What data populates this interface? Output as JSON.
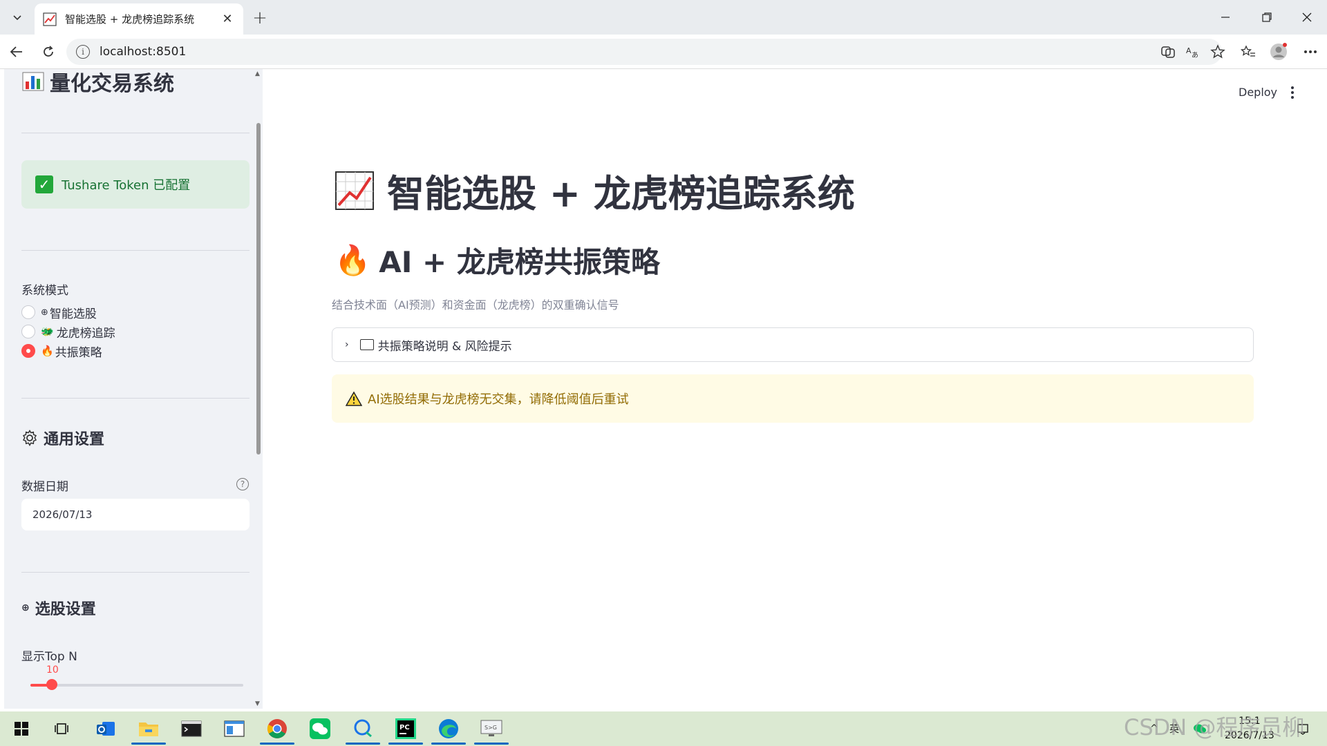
{
  "browser": {
    "tab_title": "智能选股 + 龙虎榜追踪系统",
    "close_glyph": "✕",
    "new_tab_glyph": "+",
    "url": "localhost:8501"
  },
  "sidebar": {
    "title": "量化交易系统",
    "token_status": "Tushare Token 已配置",
    "mode_label": "系统模式",
    "modes": [
      {
        "icon": "⊕",
        "label": "智能选股",
        "selected": false
      },
      {
        "icon": "🐲",
        "label": "龙虎榜追踪",
        "selected": false
      },
      {
        "icon": "🔥",
        "label": "共振策略",
        "selected": true
      }
    ],
    "general_settings_title": "通用设置",
    "date_label": "数据日期",
    "date_value": "2026/07/13",
    "stock_settings_title": "选股设置",
    "topn_label": "显示Top N",
    "topn_value": "10",
    "topn_fraction": 0.1
  },
  "main": {
    "deploy_label": "Deploy",
    "title": "智能选股 + 龙虎榜追踪系统",
    "subtitle": "AI + 龙虎榜共振策略",
    "caption": "结合技术面（AI预测）和资金面（龙虎榜）的双重确认信号",
    "expander_label": "共振策略说明 & 风险提示",
    "warning_text": "AI选股结果与龙虎榜无交集，请降低阈值后重试"
  },
  "taskbar": {
    "tray_ime": "英",
    "time": "15:1",
    "date": "2026/7/13"
  },
  "watermark": "CSDN @程序员柳",
  "colors": {
    "accent": "#ff4b4b",
    "success_bg": "#dfeee3",
    "success_text": "#177233",
    "warning_bg": "#fffbe5",
    "warning_text": "#926c05",
    "sidebar_bg": "#f0f2f6"
  }
}
